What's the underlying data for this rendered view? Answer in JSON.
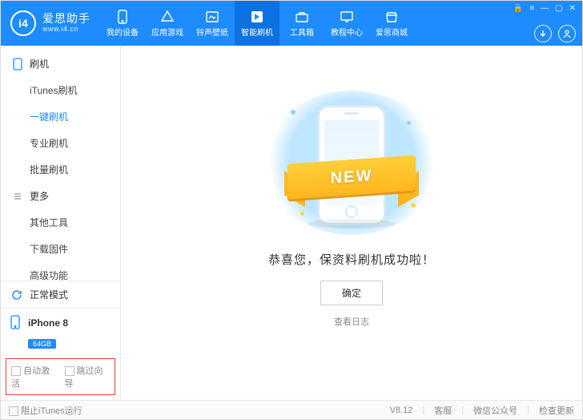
{
  "brand": {
    "logo_text": "i4",
    "title": "爱思助手",
    "subtitle": "www.i4.cn"
  },
  "nav": {
    "items": [
      {
        "label": "我的设备"
      },
      {
        "label": "应用游戏"
      },
      {
        "label": "铃声壁纸"
      },
      {
        "label": "智能刷机"
      },
      {
        "label": "工具箱"
      },
      {
        "label": "教程中心"
      },
      {
        "label": "爱思商城"
      }
    ],
    "active_index": 3
  },
  "sidebar": {
    "sections": [
      {
        "title": "刷机",
        "items": [
          "iTunes刷机",
          "一键刷机",
          "专业刷机",
          "批量刷机"
        ],
        "active_index": 1
      },
      {
        "title": "更多",
        "items": [
          "其他工具",
          "下载固件",
          "高级功能"
        ],
        "active_index": -1
      }
    ],
    "mode_label": "正常模式",
    "device": {
      "name": "iPhone 8",
      "capacity": "64GB"
    },
    "options": {
      "auto_activate": "自动激活",
      "skip_wizard": "跳过向导"
    }
  },
  "main": {
    "ribbon_text": "NEW",
    "success_text": "恭喜您，保资料刷机成功啦！",
    "confirm_label": "确定",
    "log_link": "查看日志"
  },
  "footer": {
    "block_itunes": "阻止iTunes运行",
    "version": "V8.12",
    "links": [
      "客服",
      "微信公众号",
      "检查更新"
    ]
  }
}
